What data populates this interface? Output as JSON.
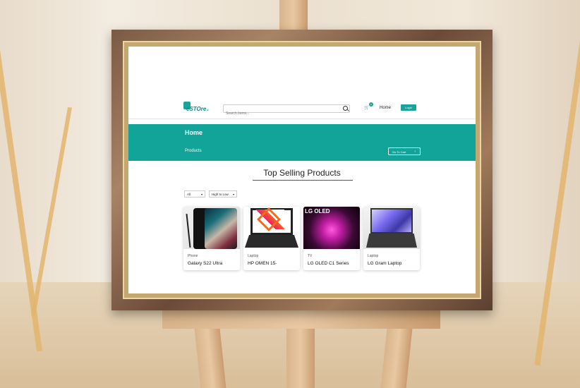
{
  "navbar": {
    "logo_text": "eSTOre",
    "logo_suffix": ".lk",
    "search_placeholder": "Search items...",
    "cart_count": "0",
    "home_label": "Home",
    "login_label": "Login"
  },
  "banner": {
    "title": "Home",
    "breadcrumb": "Products",
    "cart_button": "Go To Cart"
  },
  "section": {
    "title": "Top Selling Products"
  },
  "filters": {
    "category": "All",
    "sort": "High to Low"
  },
  "products": [
    {
      "category": "Phone",
      "name": "Galaxy S22 Ultra"
    },
    {
      "category": "Laptop",
      "name": "HP OMEN 15-"
    },
    {
      "category": "TV",
      "name": "LG OLED C1 Series",
      "image_text": "LG OLED"
    },
    {
      "category": "Laptop",
      "name": "LG Gram Laptop"
    }
  ],
  "colors": {
    "accent": "#12a499",
    "frame": "#7b5a45"
  }
}
